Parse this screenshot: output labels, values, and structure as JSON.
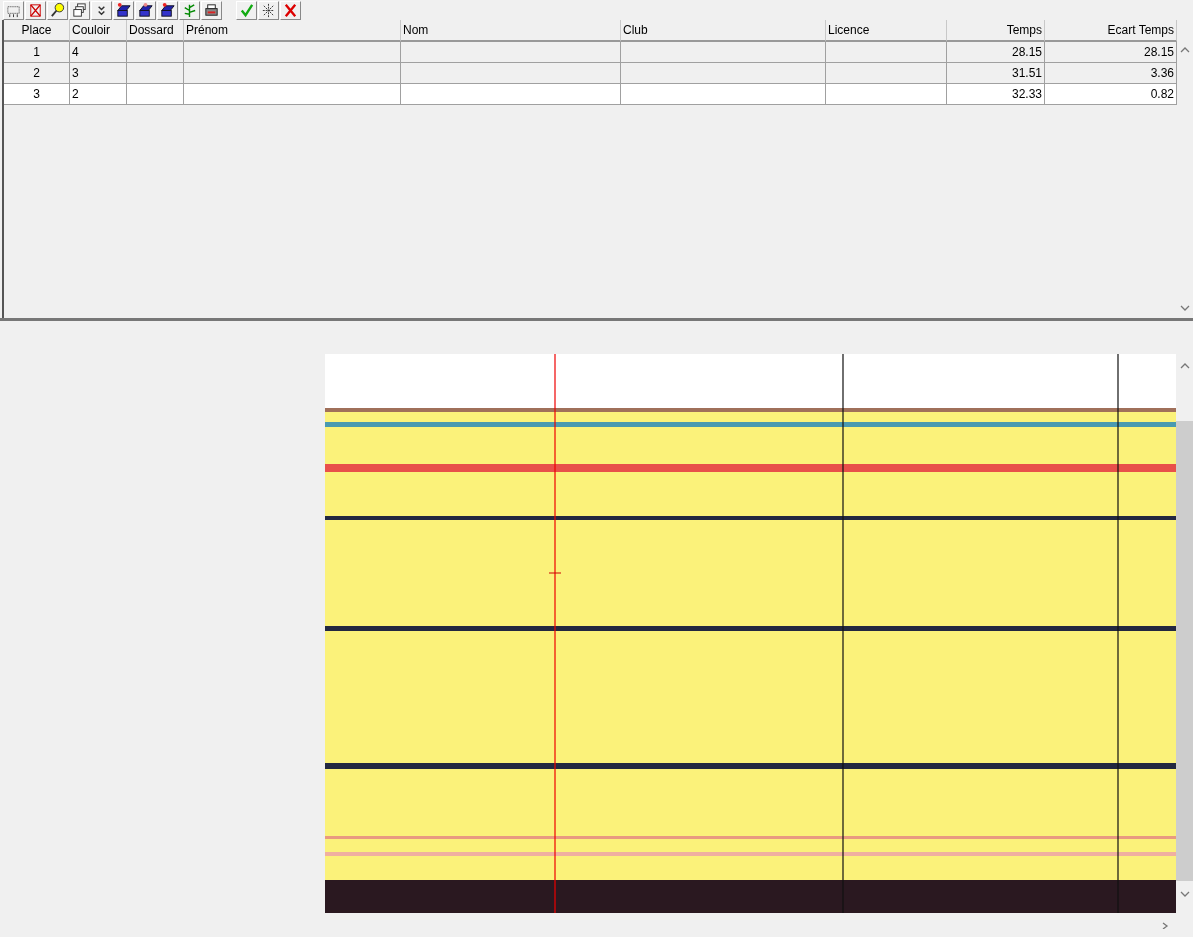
{
  "table": {
    "columns": [
      {
        "label": "Place",
        "kind": "center"
      },
      {
        "label": "Couloir",
        "kind": "left"
      },
      {
        "label": "Dossard",
        "kind": "left"
      },
      {
        "label": "Prénom",
        "kind": "left"
      },
      {
        "label": "Nom",
        "kind": "left"
      },
      {
        "label": "Club",
        "kind": "left"
      },
      {
        "label": "Licence",
        "kind": "left"
      },
      {
        "label": "Temps",
        "kind": "right"
      },
      {
        "label": "Ecart Temps",
        "kind": "right"
      }
    ],
    "rows": [
      {
        "cells": [
          "1",
          "4",
          null,
          null,
          null,
          null,
          null,
          "28.15",
          "28.15"
        ],
        "selected": true
      },
      {
        "cells": [
          "2",
          "3",
          null,
          null,
          null,
          null,
          null,
          "31.51",
          "3.36"
        ],
        "selected": true
      },
      {
        "cells": [
          "3",
          "2",
          null,
          null,
          null,
          null,
          null,
          "32.33",
          "0.82"
        ],
        "selected": false
      }
    ]
  }
}
